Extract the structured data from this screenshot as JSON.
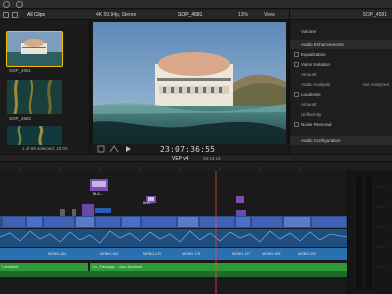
{
  "browser": {
    "filter_label": "All Clips",
    "clips": [
      {
        "name": "SOP_4581",
        "selected": true
      },
      {
        "name": "SOP_4582",
        "selected": false
      },
      {
        "name": "",
        "selected": false
      }
    ],
    "status": "1 of 69 selected, 10:03"
  },
  "viewer": {
    "format": "4K 59.94p, Stereo",
    "clip_name": "SOP_4581",
    "zoom": "13%",
    "view_menu": "View",
    "timecode": "23:07:36:55"
  },
  "inspector": {
    "clip_name": "SOP_4581",
    "rows": [
      {
        "label": "Volume",
        "type": "slider",
        "value": ""
      },
      {
        "label": "Audio Enhancements",
        "type": "section",
        "value": ""
      },
      {
        "label": "Equalization",
        "type": "checkbox",
        "value": ""
      },
      {
        "label": "Voice Isolation",
        "type": "checkbox",
        "value": ""
      },
      {
        "label": "Amount",
        "type": "indent",
        "value": ""
      },
      {
        "label": "Audio Analysis",
        "type": "indent",
        "value": "Not Analyzed"
      },
      {
        "label": "Loudness",
        "type": "checkbox",
        "value": ""
      },
      {
        "label": "Amount",
        "type": "indent",
        "value": ""
      },
      {
        "label": "Uniformity",
        "type": "indent",
        "value": ""
      },
      {
        "label": "Noise Removal",
        "type": "checkbox",
        "value": ""
      },
      {
        "label": "",
        "type": "gap",
        "value": ""
      },
      {
        "label": "Audio Configuration",
        "type": "section",
        "value": ""
      }
    ]
  },
  "timeline": {
    "project_name": "VEP v4",
    "project_time": "08:16:16",
    "connected_clips": [
      "",
      "BLA...",
      "",
      "BLA...",
      "",
      "",
      ""
    ],
    "primary_audio_labels": [
      "MONO-161",
      "MONO-162",
      "MONO-170",
      "MONO-178",
      "MONO-197",
      "MONO-199",
      "MONO-201"
    ],
    "music_tracks": [
      {
        "label": "t ambient"
      },
      {
        "label": "Ch_Passage - Jazz Ambient"
      }
    ]
  },
  "colors": {
    "accent": "#f0c000",
    "video_clip": "#3f62b8",
    "connected_clip": "#7a4fb0",
    "audio_clip": "#2f9a3a",
    "audio_lane": "#2a6fb0"
  }
}
